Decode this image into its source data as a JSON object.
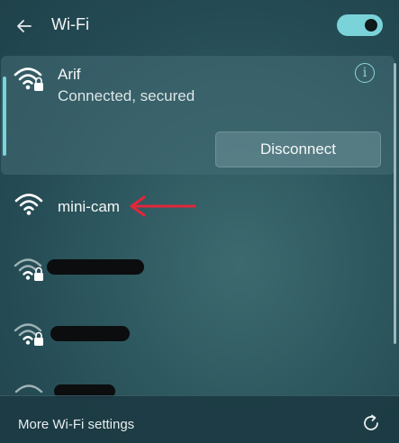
{
  "header": {
    "title": "Wi-Fi",
    "toggle_on": true,
    "accent_color": "#7ad3d8"
  },
  "connected": {
    "name": "Arif",
    "status": "Connected, secured",
    "info_icon_text": "i",
    "disconnect_label": "Disconnect"
  },
  "networks": [
    {
      "name": "mini-cam",
      "secured": false,
      "signal_icon": "wifi-full-icon"
    },
    {
      "name": "",
      "secured": true,
      "signal_icon": "wifi-secured-icon",
      "redacted": true
    },
    {
      "name": "",
      "secured": true,
      "signal_icon": "wifi-secured-icon",
      "redacted": true
    },
    {
      "name": "",
      "secured": false,
      "signal_icon": "wifi-icon",
      "redacted": true
    }
  ],
  "annotation": {
    "arrow_color": "#e2263a"
  },
  "footer": {
    "more_settings_label": "More Wi-Fi settings",
    "refresh_icon": "refresh-icon"
  }
}
